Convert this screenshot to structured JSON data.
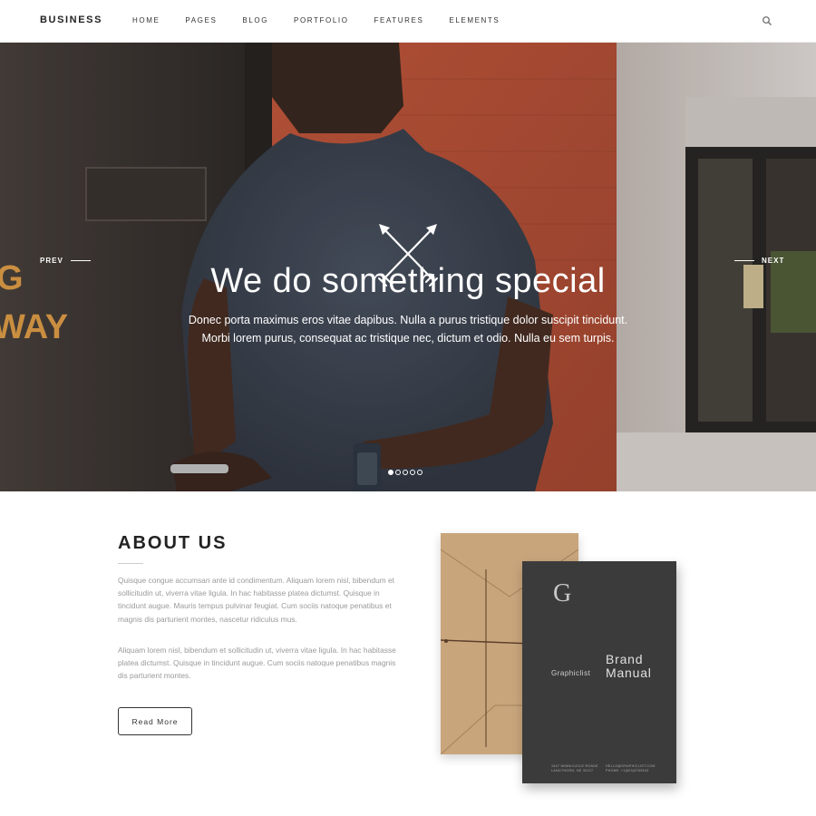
{
  "nav": {
    "brand": "BUSINESS",
    "items": [
      "HOME",
      "PAGES",
      "BLOG",
      "PORTFOLIO",
      "FEATURES",
      "ELEMENTS"
    ],
    "search_icon": "search-icon"
  },
  "hero": {
    "title": "We do something special",
    "subtitle_line1": "Donec porta maximus eros vitae dapibus. Nulla a purus tristique dolor suscipit tincidunt.",
    "subtitle_line2": "Morbi lorem purus, consequat ac tristique nec, dictum et odio. Nulla eu sem turpis.",
    "prev_label": "PREV",
    "next_label": "NEXT",
    "slides": 5,
    "active_slide": 1,
    "icon": "crossed-arrows-icon",
    "sign_text_1": "G",
    "sign_text_2": "WAY"
  },
  "about": {
    "title": "ABOUT US",
    "paragraph1": "Quisque congue accumsan ante id condimentum. Aliquam lorem nisl, bibendum et sollicitudin ut, viverra vitae ligula. In hac habitasse platea dictumst. Quisque in tincidunt augue. Mauris tempus pulvinar feugiat. Cum sociis natoque penatibus et magnis dis parturient montes, nascetur ridiculus mus.",
    "paragraph2": "Aliquam lorem nisl, bibendum et sollicitudin ut, viverra vitae ligula. In hac habitasse platea dictumst. Quisque in tincidunt augue. Cum sociis natoque penatibus magnis dis parturient montes.",
    "button_label": "Read More"
  },
  "mockup": {
    "book_letter": "G",
    "book_brand": "Graphiclist",
    "book_title_line1": "Brand",
    "book_title_line2": "Manual",
    "footer_left_1": "1547 WINNICUCLE ROADE",
    "footer_left_2": "LANGTHORN, NE 30127",
    "footer_right_1": "HELLO@GRAPHICLIST.COM",
    "footer_right_2": "PHONE: +1(623)8765543"
  },
  "colors": {
    "accent": "#222222",
    "hero_text": "#ffffff",
    "body_text": "#9a9a9a",
    "book_cover": "#3b3b3b",
    "envelope": "#c9a57c"
  }
}
